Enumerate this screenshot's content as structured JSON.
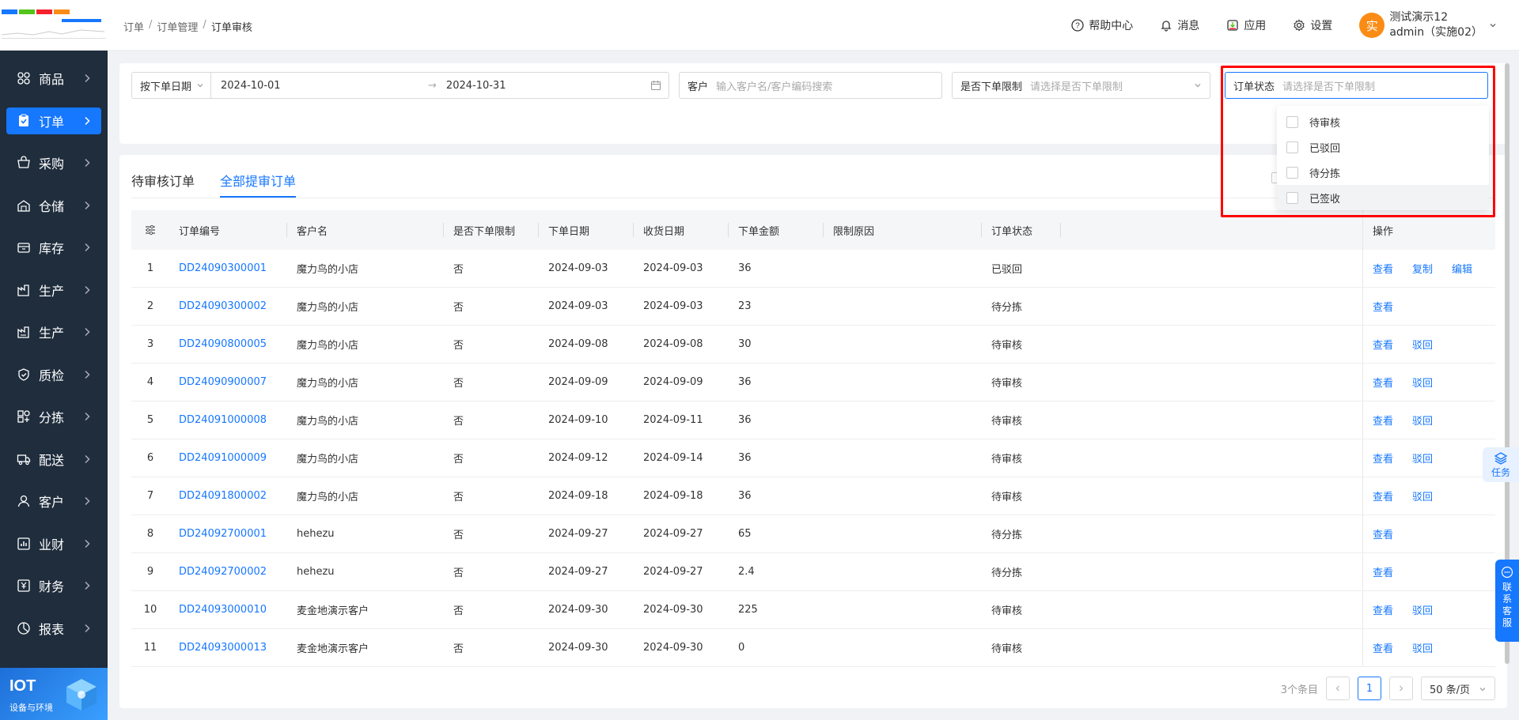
{
  "sidebar": {
    "items": [
      {
        "label": "商品",
        "icon": "product-icon"
      },
      {
        "label": "订单",
        "icon": "order-icon",
        "active": true
      },
      {
        "label": "采购",
        "icon": "purchase-icon"
      },
      {
        "label": "仓储",
        "icon": "warehouse-icon"
      },
      {
        "label": "库存",
        "icon": "inventory-icon"
      },
      {
        "label": "生产",
        "icon": "production-icon"
      },
      {
        "label": "生产",
        "icon": "production2-icon"
      },
      {
        "label": "质检",
        "icon": "quality-icon"
      },
      {
        "label": "分拣",
        "icon": "sorting-icon"
      },
      {
        "label": "配送",
        "icon": "delivery-icon"
      },
      {
        "label": "客户",
        "icon": "customer-icon"
      },
      {
        "label": "业财",
        "icon": "business-finance-icon"
      },
      {
        "label": "财务",
        "icon": "finance-icon"
      },
      {
        "label": "报表",
        "icon": "report-icon"
      }
    ],
    "iot_title": "IOT",
    "iot_subtitle": "设备与环境"
  },
  "breadcrumb": [
    "订单",
    "订单管理",
    "订单审核"
  ],
  "header": {
    "help": "帮助中心",
    "message": "消息",
    "apps": "应用",
    "settings": "设置",
    "avatar_char": "实",
    "user_name": "测试演示12",
    "user_account": "admin（实施02）"
  },
  "filters": {
    "date_type": "按下单日期",
    "date_start": "2024-10-01",
    "date_end": "2024-10-31",
    "customer_label": "客户",
    "customer_placeholder": "输入客户名/客户编码搜索",
    "limit_label": "是否下单限制",
    "limit_placeholder": "请选择是否下单限制",
    "status_label": "订单状态",
    "status_placeholder": "请选择是否下单限制"
  },
  "status_options": [
    "待审核",
    "已驳回",
    "待分拣",
    "已签收"
  ],
  "tabs": [
    "待审核订单",
    "全部提审订单"
  ],
  "table": {
    "columns": [
      "订单编号",
      "客户名",
      "是否下单限制",
      "下单日期",
      "收货日期",
      "下单金额",
      "限制原因",
      "订单状态",
      "操作"
    ],
    "rows": [
      {
        "idx": "1",
        "no": "DD24090300001",
        "name": "魔力鸟的小店",
        "limit": "否",
        "order_date": "2024-09-03",
        "recv_date": "2024-09-03",
        "amount": "36",
        "reason": "",
        "status": "已驳回",
        "ops": [
          "查看",
          "复制",
          "编辑"
        ]
      },
      {
        "idx": "2",
        "no": "DD24090300002",
        "name": "魔力鸟的小店",
        "limit": "否",
        "order_date": "2024-09-03",
        "recv_date": "2024-09-03",
        "amount": "23",
        "reason": "",
        "status": "待分拣",
        "ops": [
          "查看"
        ]
      },
      {
        "idx": "3",
        "no": "DD24090800005",
        "name": "魔力鸟的小店",
        "limit": "否",
        "order_date": "2024-09-08",
        "recv_date": "2024-09-08",
        "amount": "30",
        "reason": "",
        "status": "待审核",
        "ops": [
          "查看",
          "驳回"
        ]
      },
      {
        "idx": "4",
        "no": "DD24090900007",
        "name": "魔力鸟的小店",
        "limit": "否",
        "order_date": "2024-09-09",
        "recv_date": "2024-09-09",
        "amount": "36",
        "reason": "",
        "status": "待审核",
        "ops": [
          "查看",
          "驳回"
        ]
      },
      {
        "idx": "5",
        "no": "DD24091000008",
        "name": "魔力鸟的小店",
        "limit": "否",
        "order_date": "2024-09-10",
        "recv_date": "2024-09-11",
        "amount": "36",
        "reason": "",
        "status": "待审核",
        "ops": [
          "查看",
          "驳回"
        ]
      },
      {
        "idx": "6",
        "no": "DD24091000009",
        "name": "魔力鸟的小店",
        "limit": "否",
        "order_date": "2024-09-12",
        "recv_date": "2024-09-14",
        "amount": "36",
        "reason": "",
        "status": "待审核",
        "ops": [
          "查看",
          "驳回"
        ]
      },
      {
        "idx": "7",
        "no": "DD24091800002",
        "name": "魔力鸟的小店",
        "limit": "否",
        "order_date": "2024-09-18",
        "recv_date": "2024-09-18",
        "amount": "36",
        "reason": "",
        "status": "待审核",
        "ops": [
          "查看",
          "驳回"
        ]
      },
      {
        "idx": "8",
        "no": "DD24092700001",
        "name": "hehezu",
        "limit": "否",
        "order_date": "2024-09-27",
        "recv_date": "2024-09-27",
        "amount": "65",
        "reason": "",
        "status": "待分拣",
        "ops": [
          "查看"
        ]
      },
      {
        "idx": "9",
        "no": "DD24092700002",
        "name": "hehezu",
        "limit": "否",
        "order_date": "2024-09-27",
        "recv_date": "2024-09-27",
        "amount": "2.4",
        "reason": "",
        "status": "待分拣",
        "ops": [
          "查看"
        ]
      },
      {
        "idx": "10",
        "no": "DD24093000010",
        "name": "麦金地演示客户",
        "limit": "否",
        "order_date": "2024-09-30",
        "recv_date": "2024-09-30",
        "amount": "225",
        "reason": "",
        "status": "待审核",
        "ops": [
          "查看",
          "驳回"
        ]
      },
      {
        "idx": "11",
        "no": "DD24093000013",
        "name": "麦金地演示客户",
        "limit": "否",
        "order_date": "2024-09-30",
        "recv_date": "2024-09-30",
        "amount": "0",
        "reason": "",
        "status": "待审核",
        "ops": [
          "查看",
          "驳回"
        ]
      }
    ]
  },
  "pagination": {
    "total": "3个条目",
    "current": "1",
    "page_size": "50 条/页"
  },
  "floating": {
    "task": "任务",
    "service": [
      "联",
      "系",
      "客",
      "服"
    ]
  },
  "colors": {
    "primary": "#1677ff",
    "sidebar_bg": "#1f2d3d",
    "highlight_box": "#ff0000",
    "avatar": "#fa8c16"
  }
}
